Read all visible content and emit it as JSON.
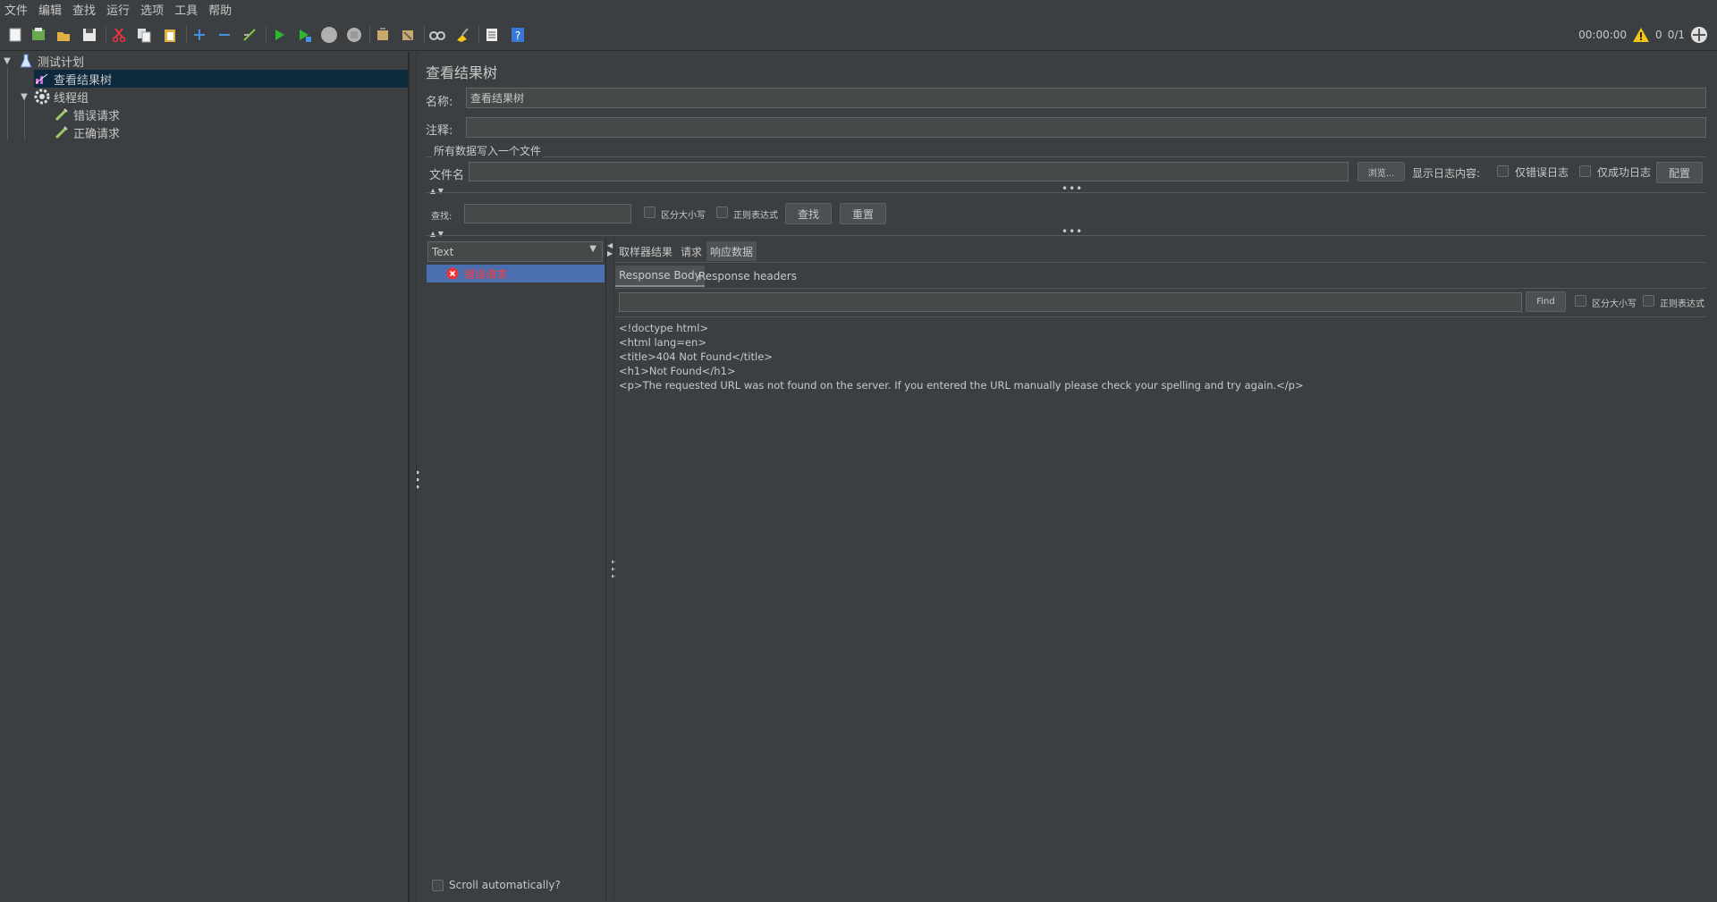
{
  "menu": [
    "文件",
    "编辑",
    "查找",
    "运行",
    "选项",
    "工具",
    "帮助"
  ],
  "toolbar": {
    "icons": [
      "new-icon",
      "templates-icon",
      "open-icon",
      "save-icon",
      "cut-icon",
      "copy-icon",
      "paste-icon",
      "expand-icon",
      "collapse-icon",
      "toggle-icon",
      "start-icon",
      "start-no-pause-icon",
      "stop-icon",
      "shutdown-icon",
      "remote-start-icon",
      "remote-clear-icon",
      "search-icon",
      "clear-all-icon",
      "function-helper-icon",
      "help-icon"
    ],
    "timer": "00:00:00",
    "warning_count": "0",
    "threads": "0/1"
  },
  "tree": {
    "items": [
      {
        "label": "测试计划",
        "icon": "test-plan-icon"
      },
      {
        "label": "查看结果树",
        "icon": "listener-icon"
      },
      {
        "label": "线程组",
        "icon": "gear-icon"
      },
      {
        "label": "错误请求",
        "icon": "sampler-icon"
      },
      {
        "label": "正确请求",
        "icon": "sampler-icon"
      }
    ]
  },
  "panel": {
    "title": "查看结果树",
    "name_label": "名称:",
    "name_value": "查看结果树",
    "comment_label": "注释:",
    "comment_value": "",
    "file_section": "所有数据写入一个文件",
    "filename_label": "文件名",
    "filename_value": "",
    "browse_button": "浏览...",
    "log_content_label": "显示日志内容:",
    "errors_only": "仅错误日志",
    "success_only": "仅成功日志",
    "configure_button": "配置",
    "search_label": "查找:",
    "search_value": "",
    "case_sensitive": "区分大小写",
    "regex": "正则表达式",
    "find_button": "查找",
    "reset_button": "重置",
    "renderer_select": "Text",
    "results": [
      {
        "label": "错误请求",
        "status": "error"
      }
    ],
    "scroll_auto": "Scroll automatically?",
    "tabs": [
      "取样器结果",
      "请求",
      "响应数据"
    ],
    "active_tab": "响应数据",
    "subtabs": [
      "Response Body",
      "Response headers"
    ],
    "active_subtab": "Response Body",
    "find_label": "Find",
    "find_case": "区分大小写",
    "find_regex": "正则表达式",
    "body_lines": [
      "<!doctype html>",
      "<html lang=en>",
      "<title>404 Not Found</title>",
      "<h1>Not Found</h1>",
      "<p>The requested URL was not found on the server. If you entered the URL manually please check your spelling and try again.</p>"
    ]
  },
  "colors": {
    "background": "#3c3f41",
    "selection": "#4b6eaf",
    "tree_selection": "#0d293e",
    "error_text": "#ff3b3b"
  }
}
